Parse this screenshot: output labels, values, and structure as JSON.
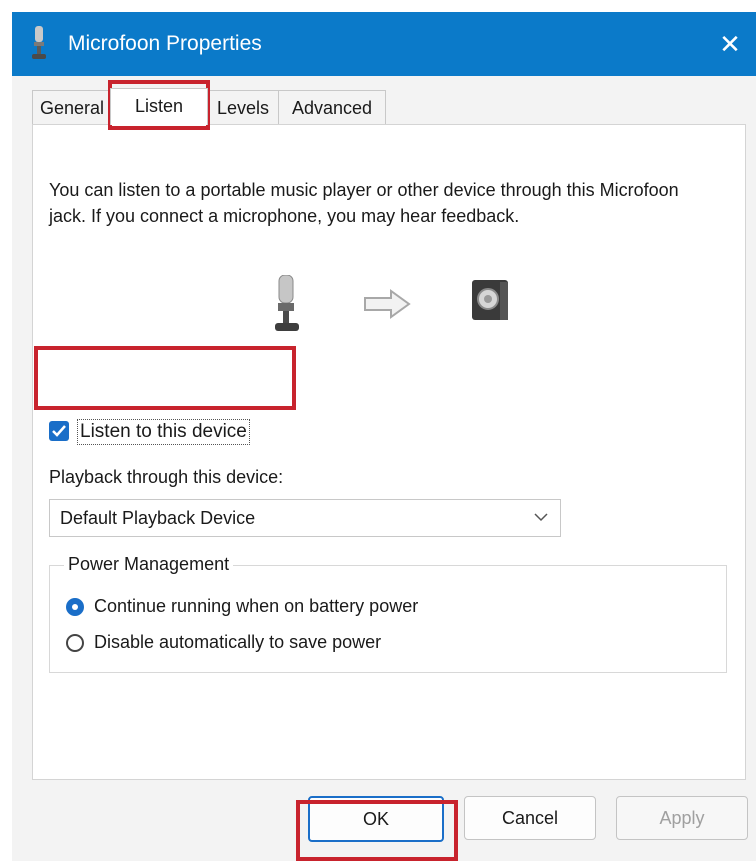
{
  "window": {
    "title": "Microfoon Properties",
    "close_glyph": "✕",
    "accent_color": "#0b7ac9"
  },
  "tabs": [
    {
      "label": "General"
    },
    {
      "label": "Listen",
      "active": true
    },
    {
      "label": "Levels"
    },
    {
      "label": "Advanced"
    }
  ],
  "listen": {
    "description": "You can listen to a portable music player or other device through this Microfoon jack.  If you connect a microphone, you may hear feedback.",
    "icons": [
      "microphone-icon",
      "arrow-right-icon",
      "speaker-icon"
    ],
    "checkbox_label": "Listen to this device",
    "checkbox_checked": true,
    "playback_label": "Playback through this device:",
    "playback_value": "Default Playback Device"
  },
  "power": {
    "legend": "Power Management",
    "options": [
      {
        "label": "Continue running when on battery power",
        "selected": true
      },
      {
        "label": "Disable automatically to save power",
        "selected": false
      }
    ]
  },
  "buttons": {
    "ok": "OK",
    "cancel": "Cancel",
    "apply": "Apply"
  },
  "annotation_color": "#c8232d"
}
